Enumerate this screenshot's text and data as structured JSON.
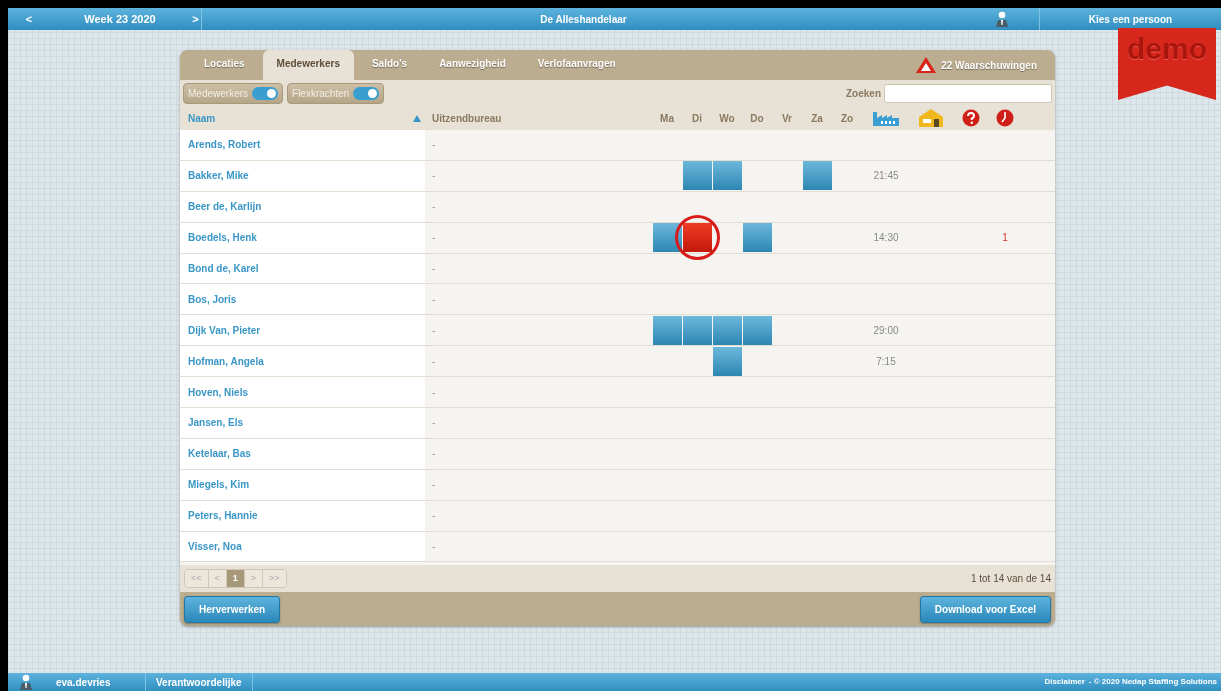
{
  "header": {
    "prev": "<",
    "week": "Week 23 2020",
    "next": ">",
    "title": "De Alleshandelaar",
    "person_button": "Kies een persoon"
  },
  "demo": "demo",
  "tabs": [
    {
      "label": "Locaties",
      "selected": false
    },
    {
      "label": "Medewerkers",
      "selected": true
    },
    {
      "label": "Saldo's",
      "selected": false
    },
    {
      "label": "Aanwezigheid",
      "selected": false
    },
    {
      "label": "Verlofaanvragen",
      "selected": false
    }
  ],
  "warnings": "22 Waarschuwingen",
  "filters": [
    {
      "label": "Medewerkers",
      "on": true
    },
    {
      "label": "Flexkrachten",
      "on": true
    }
  ],
  "search": {
    "label": "Zoeken"
  },
  "table": {
    "columns": {
      "name": "Naam",
      "agency": "Uitzendbureau",
      "days": [
        "Ma",
        "Di",
        "Wo",
        "Do",
        "Vr",
        "Za",
        "Zo"
      ]
    },
    "rows": [
      {
        "name": "Arends, Robert",
        "agency": "-"
      },
      {
        "name": "Bakker, Mike",
        "agency": "-",
        "shifts": [
          {
            "kind": "empty"
          },
          {
            "kind": "planned"
          },
          {
            "kind": "planned"
          },
          {
            "kind": "empty"
          },
          {
            "kind": "empty"
          },
          {
            "kind": "planned"
          },
          {
            "kind": "empty"
          }
        ],
        "hours": "21:45"
      },
      {
        "name": "Beer de, Karlijn",
        "agency": "-"
      },
      {
        "name": "Boedels, Henk",
        "agency": "-",
        "shifts": [
          {
            "kind": "planned"
          },
          {
            "kind": "flagged"
          },
          {
            "kind": "empty"
          },
          {
            "kind": "planned"
          },
          {
            "kind": "empty"
          },
          {
            "kind": "empty"
          },
          {
            "kind": "empty"
          }
        ],
        "hours": "14:30",
        "late": "1"
      },
      {
        "name": "Bond de, Karel",
        "agency": "-"
      },
      {
        "name": "Bos, Joris",
        "agency": "-"
      },
      {
        "name": "Dijk Van, Pieter",
        "agency": "-",
        "shifts": [
          {
            "kind": "planned"
          },
          {
            "kind": "planned"
          },
          {
            "kind": "planned"
          },
          {
            "kind": "planned"
          },
          {
            "kind": "empty"
          },
          {
            "kind": "empty"
          },
          {
            "kind": "empty"
          }
        ],
        "hours": "29:00"
      },
      {
        "name": "Hofman, Angela",
        "agency": "-",
        "shifts": [
          {
            "kind": "empty"
          },
          {
            "kind": "empty"
          },
          {
            "kind": "planned"
          },
          {
            "kind": "empty"
          },
          {
            "kind": "empty"
          },
          {
            "kind": "empty"
          },
          {
            "kind": "empty"
          }
        ],
        "hours": "7:15"
      },
      {
        "name": "Hoven, Niels",
        "agency": "-"
      },
      {
        "name": "Jansen, Els",
        "agency": "-"
      },
      {
        "name": "Ketelaar, Bas",
        "agency": "-"
      },
      {
        "name": "Miegels, Kim",
        "agency": "-"
      },
      {
        "name": "Peters, Hannie",
        "agency": "-"
      },
      {
        "name": "Visser, Noa",
        "agency": "-"
      }
    ]
  },
  "pager": {
    "buttons": [
      {
        "label": "<<",
        "selected": false
      },
      {
        "label": "<",
        "selected": false
      },
      {
        "label": "1",
        "selected": true
      },
      {
        "label": ">",
        "selected": false
      },
      {
        "label": ">>",
        "selected": false
      }
    ],
    "info": "1 tot 14 van de 14"
  },
  "actions": [
    "Herverwerken",
    "Download voor Excel"
  ],
  "footer": {
    "user": "eva.devries",
    "role": "Verantwoordelijke",
    "disclaimer": "Disclaimer",
    "copyright": "- © 2020 Nedap Staffing Solutions"
  }
}
